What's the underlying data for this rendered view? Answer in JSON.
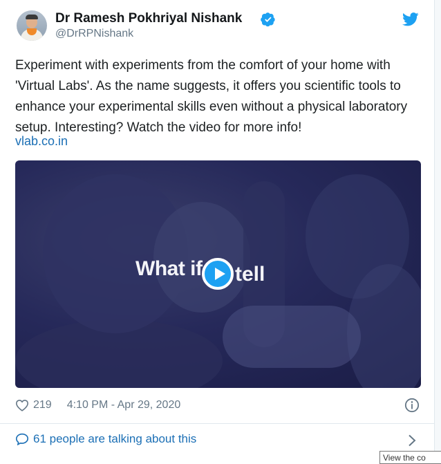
{
  "tweet": {
    "author_name": "Dr Ramesh Pokhriyal Nishank",
    "handle": "@DrRPNishank",
    "text": "Experiment with experiments from the comfort of your home with 'Virtual Labs'. As the name suggests, it offers you scientific tools to enhance your experimental skills even without a physical laboratory setup. Interesting? Watch the video for more info!",
    "link": "vlab.co.in",
    "video_overlay_left": "What if",
    "video_overlay_right": "tell",
    "likes": "219",
    "timestamp": "4:10 PM - Apr 29, 2020",
    "conversation": "61 people are talking about this"
  },
  "tooltip": "View the co",
  "icons": {
    "verified": "verified-badge-icon",
    "bird": "twitter-bird-icon",
    "heart": "heart-icon",
    "info": "info-icon",
    "bubble": "comment-bubble-icon",
    "chevron": "chevron-right-icon",
    "play": "play-icon"
  },
  "colors": {
    "accent": "#1da1f2",
    "link": "#1b6fb5",
    "muted": "#657786",
    "video_bg": "#26295a"
  }
}
